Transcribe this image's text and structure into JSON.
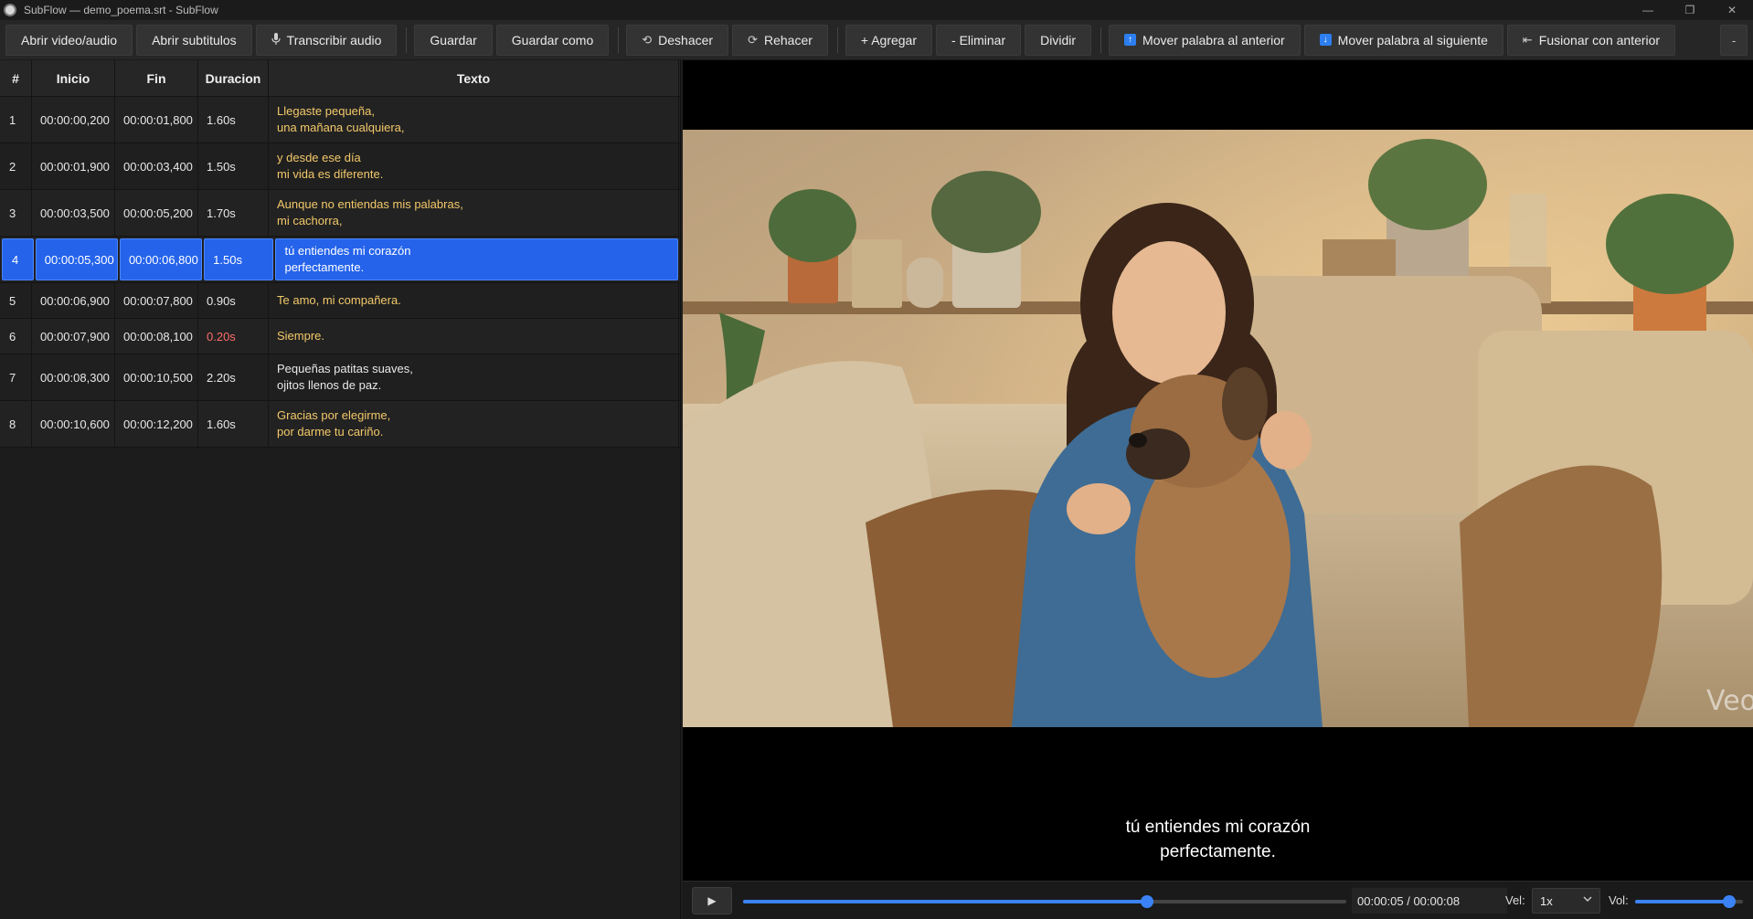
{
  "window": {
    "title": "SubFlow — demo_poema.srt - SubFlow",
    "minimize": "—",
    "maximize": "❐",
    "close": "✕"
  },
  "toolbar": {
    "open_video": "Abrir video/audio",
    "open_subs": "Abrir subtitulos",
    "transcribe": "Transcribir audio",
    "save": "Guardar",
    "save_as": "Guardar como",
    "undo": "Deshacer",
    "redo": "Rehacer",
    "add": "+ Agregar",
    "delete": "- Eliminar",
    "split": "Dividir",
    "move_prev": "Mover palabra al anterior",
    "move_next": "Mover palabra al siguiente",
    "merge_prev": "Fusionar con anterior",
    "more": "-",
    "undo_glyph": "⟲",
    "redo_glyph": "⟳",
    "merge_glyph": "⇤",
    "arrow_up_glyph": "↑",
    "arrow_down_glyph": "↓"
  },
  "table": {
    "headers": [
      "#",
      "Inicio",
      "Fin",
      "Duracion",
      "Texto"
    ],
    "rows": [
      {
        "n": "1",
        "start": "00:00:00,200",
        "end": "00:00:01,800",
        "dur": "1.60s",
        "l1": "Llegaste pequeña,",
        "l2": "una mañana cualquiera,"
      },
      {
        "n": "2",
        "start": "00:00:01,900",
        "end": "00:00:03,400",
        "dur": "1.50s",
        "l1": "y desde ese día",
        "l2": "mi vida es diferente."
      },
      {
        "n": "3",
        "start": "00:00:03,500",
        "end": "00:00:05,200",
        "dur": "1.70s",
        "l1": "Aunque no entiendas mis palabras,",
        "l2": "mi cachorra,"
      },
      {
        "n": "4",
        "start": "00:00:05,300",
        "end": "00:00:06,800",
        "dur": "1.50s",
        "l1": "tú entiendes mi corazón",
        "l2": "perfectamente."
      },
      {
        "n": "5",
        "start": "00:00:06,900",
        "end": "00:00:07,800",
        "dur": "0.90s",
        "l1": "Te amo, mi compañera.",
        "l2": ""
      },
      {
        "n": "6",
        "start": "00:00:07,900",
        "end": "00:00:08,100",
        "dur": "0.20s",
        "l1": "Siempre.",
        "l2": ""
      },
      {
        "n": "7",
        "start": "00:00:08,300",
        "end": "00:00:10,500",
        "dur": "2.20s",
        "l1": "Pequeñas patitas suaves,",
        "l2": "ojitos llenos de paz."
      },
      {
        "n": "8",
        "start": "00:00:10,600",
        "end": "00:00:12,200",
        "dur": "1.60s",
        "l1": "Gracias por elegirme,",
        "l2": "por darme tu cariño."
      }
    ]
  },
  "player": {
    "subtitle_l1": "tú entiendes mi corazón",
    "subtitle_l2": "perfectamente.",
    "play_glyph": "▶",
    "time": "00:00:05 / 00:00:08",
    "progress_fraction": 0.67,
    "vel_label": "Vel:",
    "vel_value": "1x",
    "vol_label": "Vol:",
    "volume_fraction": 0.87,
    "watermark": "Veo"
  },
  "colors": {
    "accent": "#2563eb",
    "text_yellow": "#f3c96a",
    "warning": "#ff6b6b"
  }
}
